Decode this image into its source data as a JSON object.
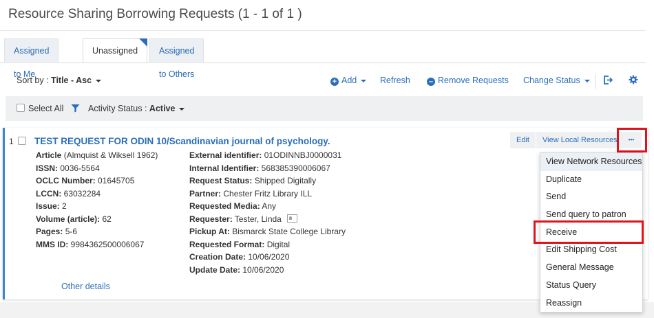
{
  "page": {
    "title": "Resource Sharing Borrowing Requests (1 - 1 of 1 )"
  },
  "tabs": [
    {
      "label": "Assigned to Me"
    },
    {
      "label": "Unassigned"
    },
    {
      "label": "Assigned to Others"
    }
  ],
  "toolbar": {
    "sort_prefix": "Sort by : ",
    "sort_value": "Title - Asc",
    "add_label": "Add",
    "refresh_label": "Refresh",
    "remove_label": "Remove Requests",
    "change_status_label": "Change Status"
  },
  "filter": {
    "select_all_label": "Select All",
    "activity_prefix": "Activity Status : ",
    "activity_value": "Active"
  },
  "record": {
    "index": "1",
    "title": "TEST REQUEST FOR ODIN 10/Scandinavian journal of psychology.",
    "col1": [
      {
        "key": "Article",
        "value": " (Almquist & Wiksell 1962)"
      },
      {
        "key": "ISSN:",
        "value": " 0036-5564"
      },
      {
        "key": "OCLC Number:",
        "value": " 01645705"
      },
      {
        "key": "LCCN:",
        "value": " 63032284"
      },
      {
        "key": "Issue:",
        "value": " 2"
      },
      {
        "key": "Volume (article):",
        "value": " 62"
      },
      {
        "key": "Pages:",
        "value": " 5-6"
      },
      {
        "key": "MMS ID:",
        "value": " 9984362500006067"
      }
    ],
    "col2": [
      {
        "key": "External identifier:",
        "value": " 01ODINNBJ0000031"
      },
      {
        "key": "Internal Identifier:",
        "value": " 568385390006067"
      },
      {
        "key": "Request Status:",
        "value": " Shipped Digitally"
      },
      {
        "key": "Partner:",
        "value": " Chester Fritz Library ILL"
      },
      {
        "key": "Requested Media:",
        "value": " Any"
      },
      {
        "key": "Requester:",
        "value": " Tester, Linda"
      },
      {
        "key": "Pickup At:",
        "value": " Bismarck State College Library"
      },
      {
        "key": "Requested Format:",
        "value": " Digital"
      },
      {
        "key": "Creation Date:",
        "value": " 10/06/2020"
      },
      {
        "key": "Update Date:",
        "value": " 10/06/2020"
      }
    ],
    "other_details": "Other details",
    "edit_label": "Edit",
    "view_local_label": "View Local Resources",
    "more_label": "•••"
  },
  "menu": {
    "items": [
      "View Network Resources",
      "Duplicate",
      "Send",
      "Send query to patron",
      "Receive",
      "Edit Shipping Cost",
      "General Message",
      "Status Query",
      "Reassign"
    ]
  },
  "colors": {
    "accent": "#2a6ebb",
    "highlight_box": "#e0121b"
  }
}
